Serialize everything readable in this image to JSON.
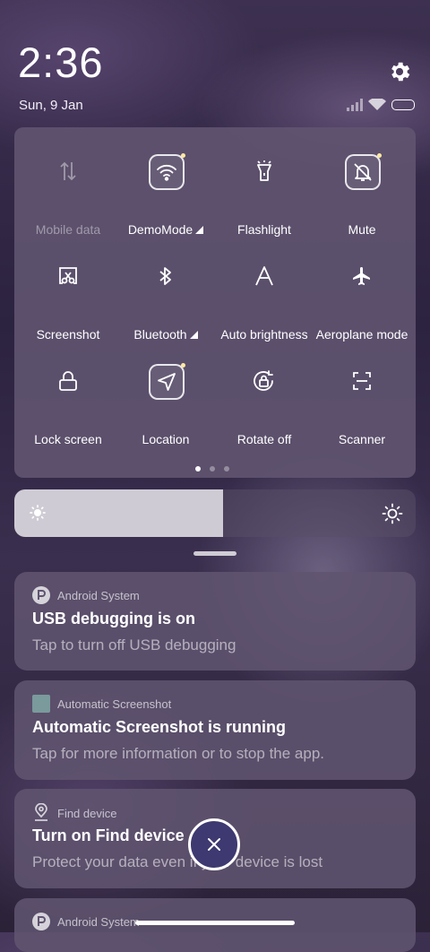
{
  "status": {
    "time": "2:36",
    "date": "Sun, 9 Jan"
  },
  "quick_settings": {
    "tiles": [
      {
        "label": "Mobile data",
        "icon": "mobile-data-icon",
        "active": false,
        "disabled": true
      },
      {
        "label": "DemoMode",
        "icon": "wifi-icon",
        "active": true,
        "has_menu": true
      },
      {
        "label": "Flashlight",
        "icon": "flashlight-icon",
        "active": false
      },
      {
        "label": "Mute",
        "icon": "mute-bell-icon",
        "active": true
      },
      {
        "label": "Screenshot",
        "icon": "screenshot-scissors-icon",
        "active": false
      },
      {
        "label": "Bluetooth",
        "icon": "bluetooth-icon",
        "active": false,
        "has_menu": true
      },
      {
        "label": "Auto brightness",
        "icon": "auto-brightness-icon",
        "active": false
      },
      {
        "label": "Aeroplane mode",
        "icon": "aeroplane-icon",
        "active": false
      },
      {
        "label": "Lock screen",
        "icon": "lock-icon",
        "active": false
      },
      {
        "label": "Location",
        "icon": "location-arrow-icon",
        "active": true
      },
      {
        "label": "Rotate off",
        "icon": "rotate-lock-icon",
        "active": false
      },
      {
        "label": "Scanner",
        "icon": "scanner-icon",
        "active": false
      }
    ],
    "pages": 3,
    "current_page": 1
  },
  "brightness": {
    "level": 0.52
  },
  "notifications": [
    {
      "app": "Android System",
      "title": "USB debugging is on",
      "body": "Tap to turn off USB debugging"
    },
    {
      "app": "Automatic Screenshot",
      "title": "Automatic Screenshot is running",
      "body": "Tap for more information or to stop the app."
    },
    {
      "app": "Find device",
      "title": "Turn on Find device",
      "body": "Protect your data even if your device is lost"
    },
    {
      "app": "Android System"
    }
  ],
  "colors": {
    "panel": "#605470",
    "fab": "#3e3970",
    "active_dot": "#ffe9a0"
  }
}
